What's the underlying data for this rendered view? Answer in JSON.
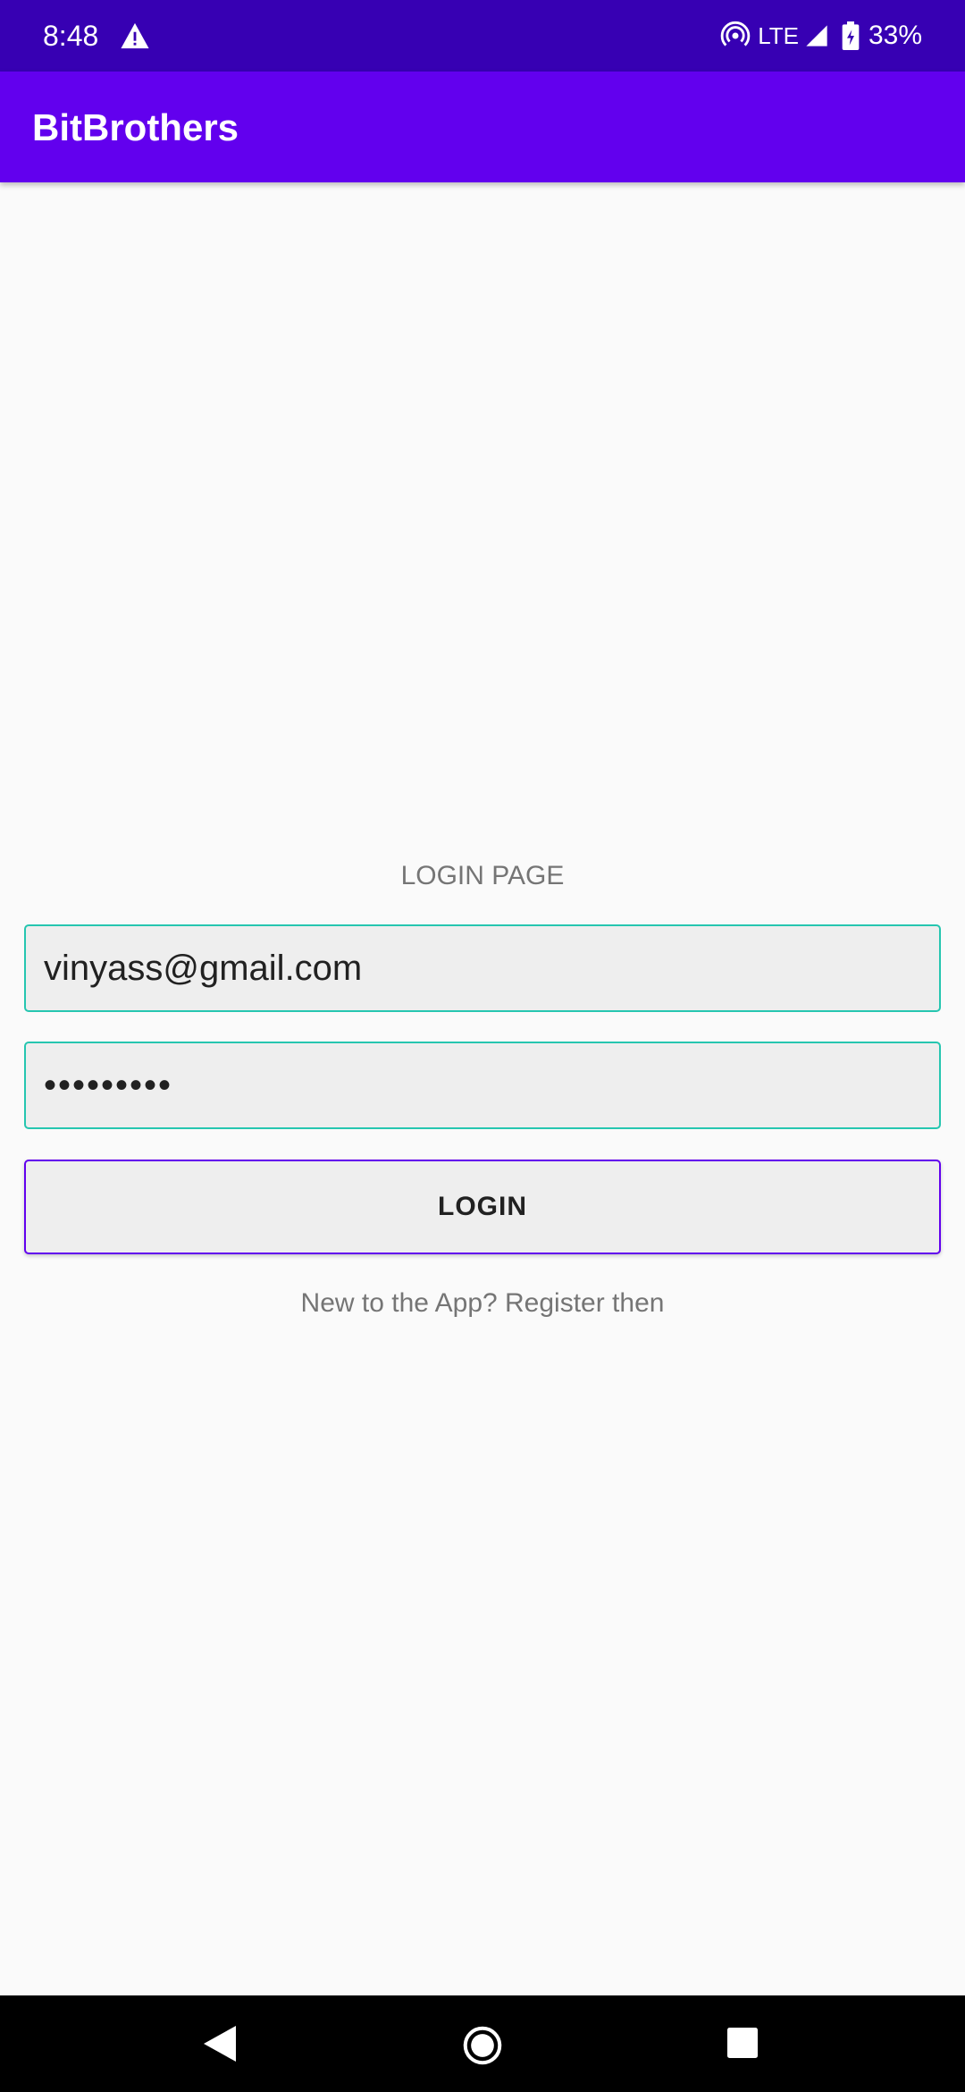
{
  "status_bar": {
    "time": "8:48",
    "network": "LTE",
    "battery": "33%",
    "icons": [
      "warning-icon",
      "hotspot-icon",
      "signal-icon",
      "battery-icon"
    ]
  },
  "app_bar": {
    "title": "BitBrothers"
  },
  "login": {
    "heading": "LOGIN PAGE",
    "email_value": "vinyass@gmail.com",
    "password_value": "vinyass12",
    "button_label": "LOGIN",
    "register_text": "New to the App? Register then"
  },
  "nav_bar": {
    "icons": [
      "back-icon",
      "home-icon",
      "recents-icon"
    ]
  },
  "colors": {
    "status_bar": "#3700b3",
    "app_bar": "#6200ee",
    "field_border": "#26c6b0",
    "button_border": "#6200ee",
    "background": "#fafafa"
  }
}
